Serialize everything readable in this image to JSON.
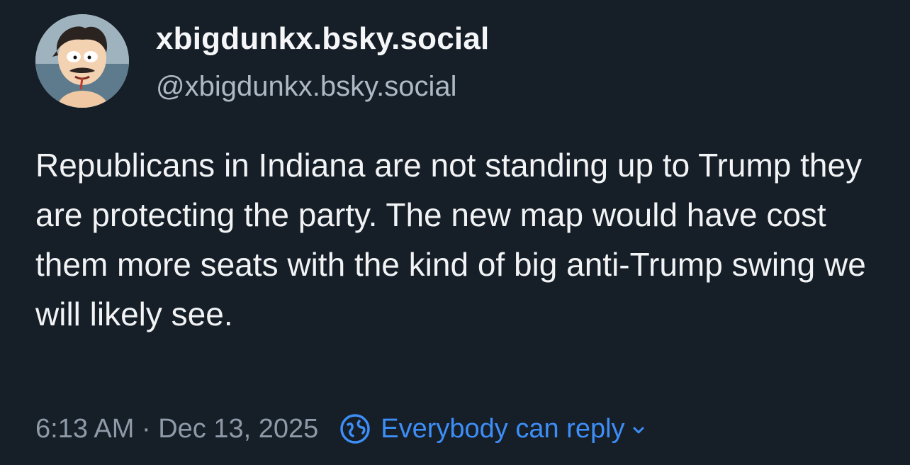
{
  "author": {
    "display_name": "xbigdunkx.bsky.social",
    "handle": "@xbigdunkx.bsky.social",
    "avatar": "cartoon-character-avatar"
  },
  "post": {
    "text": "Republicans in Indiana are not standing up to Trump they are protecting the party. The new map would have cost them more seats with the kind of big anti-Trump swing we will likely see."
  },
  "meta": {
    "timestamp": "6:13 AM · Dec 13, 2025",
    "reply_setting": "Everybody can reply",
    "reply_icon": "globe-icon",
    "dropdown_icon": "chevron-down-icon"
  },
  "colors": {
    "background": "#161e27",
    "text": "#f1f3f5",
    "muted": "#8e9aa8",
    "accent": "#3d8ef7"
  }
}
